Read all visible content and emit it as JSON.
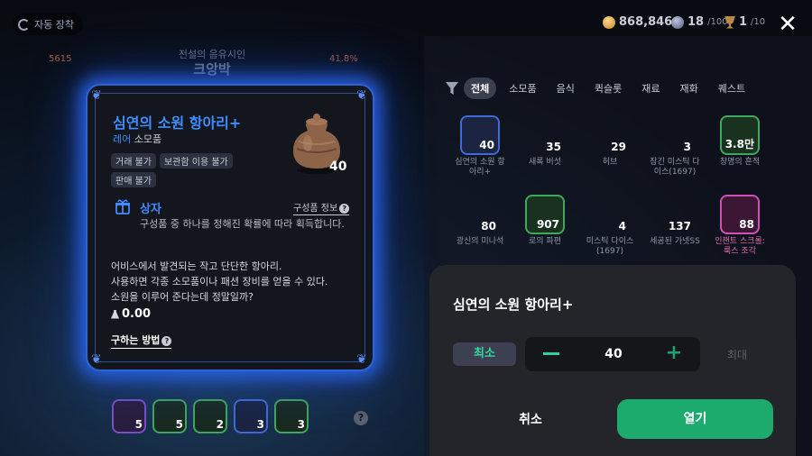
{
  "topbar": {
    "auto_equip_label": "자동 장착",
    "gold": "868,846",
    "pearls": "18",
    "pearls_max": "/100",
    "trophy": "1",
    "trophy_max": "/10"
  },
  "background": {
    "hero_subtitle": "전설의 음유시인",
    "hero_name": "크앙박",
    "stat_left": "5615",
    "stat_right": "41.8%",
    "bottom_slots": [
      "5",
      "5",
      "2",
      "3",
      "3"
    ]
  },
  "item_card": {
    "title": "심연의 소원 항아리+",
    "rarity": "레어",
    "category": "소모품",
    "tags": [
      "거래 불가",
      "보관함 이용 불가",
      "판매 불가"
    ],
    "count": "40",
    "sub_title": "상자",
    "sub_link": "구성품 정보",
    "sub_desc": "구성품 중 하나를 정해진 확률에 따라 획득합니다.",
    "description": [
      "어비스에서 발견되는 작고 단단한 항아리.",
      "사용하면 각종 소모품이나 패션 장비를 얻을 수 있다.",
      "소원을 이루어 준다는데 정말일까?"
    ],
    "weight": "0.00",
    "how_to_get": "구하는 방법"
  },
  "inventory": {
    "filters": [
      "전체",
      "소모품",
      "음식",
      "퀵슬롯",
      "재료",
      "재화",
      "퀘스트"
    ],
    "items": [
      {
        "count": "40",
        "label": "심연의 소원 항아리+",
        "color": "#3f6bd8"
      },
      {
        "count": "35",
        "label": "새록 버섯",
        "color": ""
      },
      {
        "count": "29",
        "label": "허브",
        "color": ""
      },
      {
        "count": "3",
        "label": "잠긴 미스틱 다이스(1697)",
        "color": ""
      },
      {
        "count": "3.8만",
        "label": "창명의 흔적",
        "color": "#3fa85a"
      },
      {
        "count": "80",
        "label": "광신의 미나석",
        "color": ""
      },
      {
        "count": "907",
        "label": "로의 파편",
        "color": "#3fa85a"
      },
      {
        "count": "4",
        "label": "미스틱 다이스(1697)",
        "color": ""
      },
      {
        "count": "137",
        "label": "세공된 가넷SS",
        "color": ""
      },
      {
        "count": "88",
        "label": "인챈트 스크롤: 룩스 조각",
        "color": "#d050b8"
      }
    ]
  },
  "sheet": {
    "title": "심연의 소원 항아리+",
    "min_label": "최소",
    "quantity": "40",
    "max_label": "최대",
    "cancel_label": "취소",
    "open_label": "열기"
  }
}
